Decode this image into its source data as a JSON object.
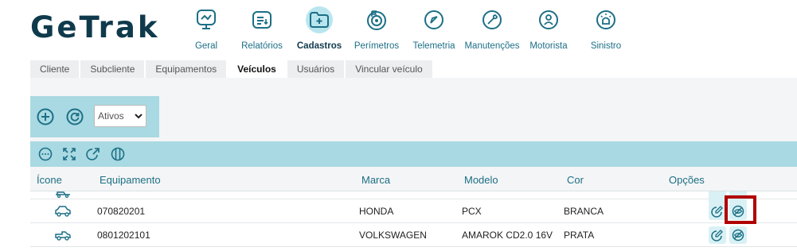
{
  "app": {
    "logo": "GeTrak"
  },
  "nav": [
    {
      "label": "Geral",
      "icon": "monitor-chart-icon"
    },
    {
      "label": "Relatórios",
      "icon": "report-list-icon"
    },
    {
      "label": "Cadastros",
      "icon": "folder-plus-icon",
      "active": true
    },
    {
      "label": "Perímetros",
      "icon": "target-icon"
    },
    {
      "label": "Telemetria",
      "icon": "gauge-icon"
    },
    {
      "label": "Manutenções",
      "icon": "wrench-icon"
    },
    {
      "label": "Motorista",
      "icon": "driver-icon"
    },
    {
      "label": "Sinistro",
      "icon": "alarm-icon"
    }
  ],
  "tabs": [
    {
      "label": "Cliente"
    },
    {
      "label": "Subcliente"
    },
    {
      "label": "Equipamentos"
    },
    {
      "label": "Veículos",
      "active": true
    },
    {
      "label": "Usuários"
    },
    {
      "label": "Vincular veículo"
    }
  ],
  "toolbar": {
    "status_filter": "Ativos"
  },
  "table": {
    "columns": [
      "Ícone",
      "Equipamento",
      "Marca",
      "Modelo",
      "Cor",
      "Opções"
    ],
    "rows": [
      {
        "icon": "car-icon",
        "equipamento": "070820201",
        "marca": "HONDA",
        "modelo": "PCX",
        "cor": "BRANCA"
      },
      {
        "icon": "pickup-icon",
        "equipamento": "0801202101",
        "marca": "VOLKSWAGEN",
        "modelo": "AMAROK CD2.0 16V",
        "cor": "PRATA"
      }
    ]
  },
  "colors": {
    "accent": "#1c6f86",
    "toolbar": "#a9d9e2",
    "logo": "#0f3a4c",
    "highlight": "#b00000"
  }
}
